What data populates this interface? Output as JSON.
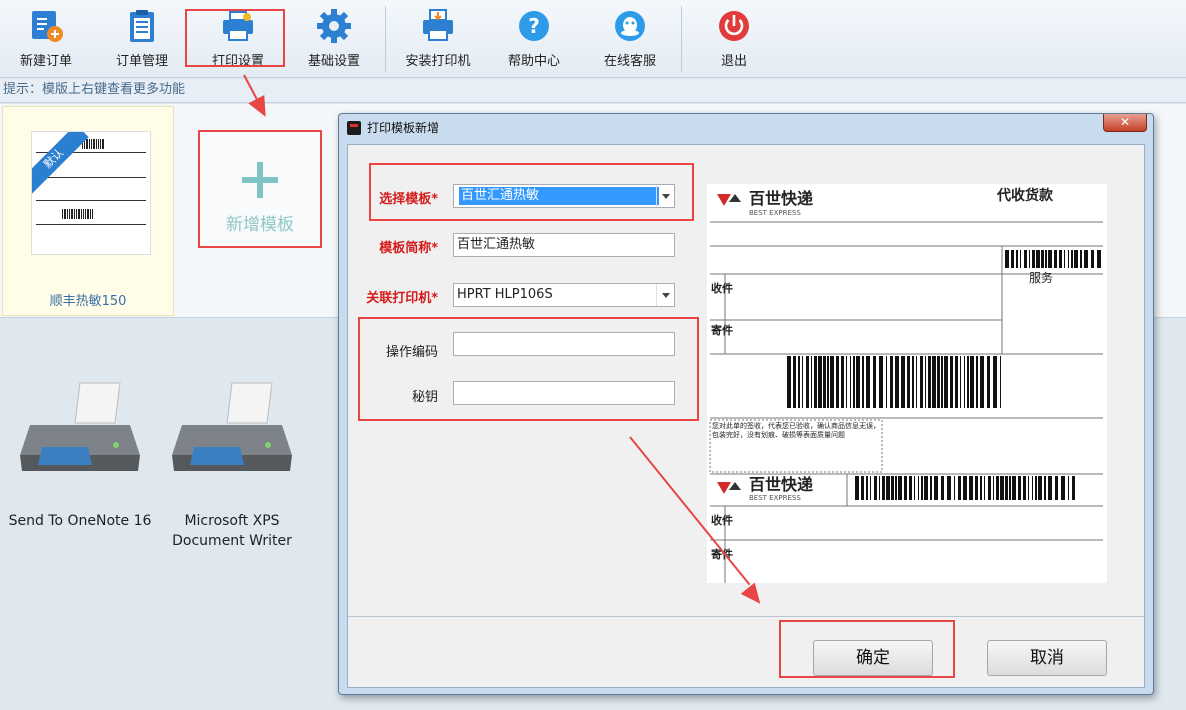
{
  "toolbar": {
    "buttons": [
      {
        "label": "新建订单",
        "icon": "new-order-icon"
      },
      {
        "label": "订单管理",
        "icon": "clipboard-icon"
      },
      {
        "label": "打印设置",
        "icon": "printer-settings-icon"
      },
      {
        "label": "基础设置",
        "icon": "gear-icon"
      },
      {
        "label": "安装打印机",
        "icon": "install-printer-icon"
      },
      {
        "label": "帮助中心",
        "icon": "help-icon"
      },
      {
        "label": "在线客服",
        "icon": "chat-icon"
      },
      {
        "label": "退出",
        "icon": "power-icon"
      }
    ]
  },
  "hint": "提示：模版上右键查看更多功能",
  "templates": {
    "card_name": "顺丰热敏150",
    "ribbon": "默认",
    "add_label": "新增模板"
  },
  "printers": [
    {
      "name": "Send To OneNote 16"
    },
    {
      "name": "Microsoft XPS Document Writer"
    }
  ],
  "dialog": {
    "title": "打印模板新增",
    "close": "✕",
    "fields": {
      "template_label": "选择模板*",
      "template_value": "百世汇通热敏",
      "short_name_label": "模板简称*",
      "short_name_value": "百世汇通热敏",
      "printer_label": "关联打印机*",
      "printer_value": "HPRT HLP106S",
      "op_code_label": "操作编码",
      "op_code_value": "",
      "secret_label": "秘钥",
      "secret_value": ""
    },
    "preview": {
      "brand": "百世快递",
      "brand_en": "BEST EXPRESS",
      "cod": "代收货款",
      "service": "服务",
      "recv": "收件",
      "send": "寄件",
      "notice": "您对此单的签收，代表您已验收，确认商品信息无误，包装完好，没有划痕、破损等表面质量问题"
    },
    "ok": "确定",
    "cancel": "取消"
  },
  "colors": {
    "highlight": "#e84545",
    "accent": "#2a7fd0"
  }
}
